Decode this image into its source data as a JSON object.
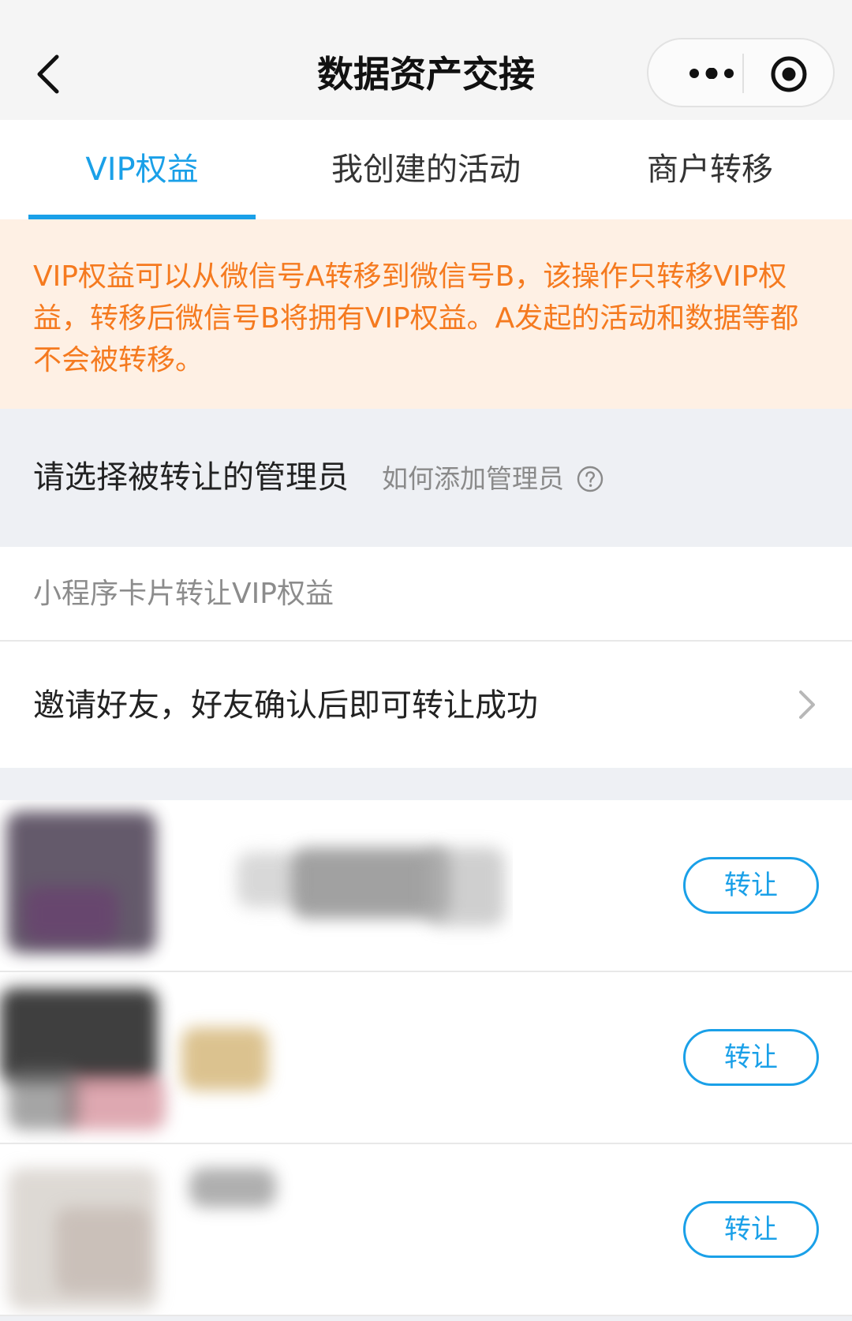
{
  "nav": {
    "title": "数据资产交接",
    "icons": {
      "back": "chevron-left-icon",
      "more": "more-dots-icon",
      "close": "target-icon"
    }
  },
  "tabs": [
    {
      "label": "VIP权益",
      "active": true
    },
    {
      "label": "我创建的活动",
      "active": false
    },
    {
      "label": "商户转移",
      "active": false
    }
  ],
  "notice": {
    "text": "VIP权益可以从微信号A转移到微信号B，该操作只转移VIP权益，转移后微信号B将拥有VIP权益。A发起的活动和数据等都不会被转移。"
  },
  "section": {
    "title": "请选择被转让的管理员",
    "help_link": "如何添加管理员"
  },
  "hint": {
    "text": "小程序卡片转让VIP权益"
  },
  "invite": {
    "text": "邀请好友，好友确认后即可转让成功"
  },
  "admins": [
    {
      "button_label": "转让"
    },
    {
      "button_label": "转让"
    },
    {
      "button_label": "转让"
    }
  ],
  "colors": {
    "accent": "#1aa0e8",
    "notice_text": "#f57a1f",
    "notice_bg": "#fef0e4",
    "page_bg": "#eef0f4"
  }
}
